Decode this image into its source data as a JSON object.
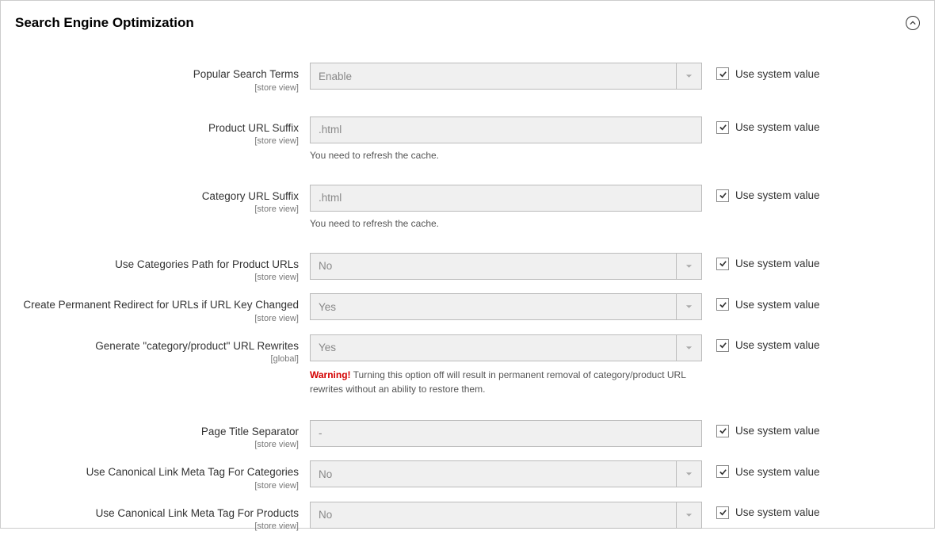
{
  "header": {
    "title": "Search Engine Optimization"
  },
  "common": {
    "scope_store": "[store view]",
    "scope_global": "[global]",
    "use_system_value": "Use system value",
    "refresh_cache": "You need to refresh the cache."
  },
  "fields": {
    "popular_search_terms": {
      "label": "Popular Search Terms",
      "value": "Enable"
    },
    "product_url_suffix": {
      "label": "Product URL Suffix",
      "value": ".html"
    },
    "category_url_suffix": {
      "label": "Category URL Suffix",
      "value": ".html"
    },
    "categories_path": {
      "label": "Use Categories Path for Product URLs",
      "value": "No"
    },
    "permanent_redirect": {
      "label": "Create Permanent Redirect for URLs if URL Key Changed",
      "value": "Yes"
    },
    "generate_rewrites": {
      "label": "Generate \"category/product\" URL Rewrites",
      "value": "Yes",
      "warning_label": "Warning!",
      "warning_text": " Turning this option off will result in permanent removal of category/product URL rewrites without an ability to restore them."
    },
    "page_title_separator": {
      "label": "Page Title Separator",
      "value": "-"
    },
    "canonical_categories": {
      "label": "Use Canonical Link Meta Tag For Categories",
      "value": "No"
    },
    "canonical_products": {
      "label": "Use Canonical Link Meta Tag For Products",
      "value": "No"
    }
  }
}
